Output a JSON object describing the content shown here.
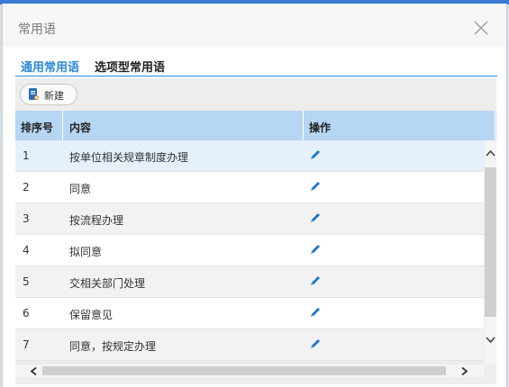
{
  "dialog": {
    "title": "常用语"
  },
  "tabs": [
    {
      "label": "通用常用语",
      "active": true
    },
    {
      "label": "选项型常用语",
      "active": false
    }
  ],
  "toolbar": {
    "new_label": "新建"
  },
  "table": {
    "columns": [
      "排序号",
      "内容",
      "操作"
    ],
    "rows": [
      {
        "num": "1",
        "content": "按单位相关规章制度办理",
        "action": "edit-icon"
      },
      {
        "num": "2",
        "content": "同意",
        "action": "edit-icon"
      },
      {
        "num": "3",
        "content": "按流程办理",
        "action": "edit-icon"
      },
      {
        "num": "4",
        "content": "拟同意",
        "action": "edit-icon"
      },
      {
        "num": "5",
        "content": "交相关部门处理",
        "action": "edit-icon"
      },
      {
        "num": "6",
        "content": "保留意见",
        "action": "edit-icon"
      },
      {
        "num": "7",
        "content": "同意，按规定办理",
        "action": "edit-icon"
      }
    ]
  },
  "colors": {
    "accent": "#2d8ad7",
    "header_bg": "#b6d6f4",
    "selected_row_bg": "#e5f0fb",
    "alt_row_bg": "#f2f2f2",
    "row_bg": "#ffffff",
    "edit_icon": "#1f74c8"
  }
}
